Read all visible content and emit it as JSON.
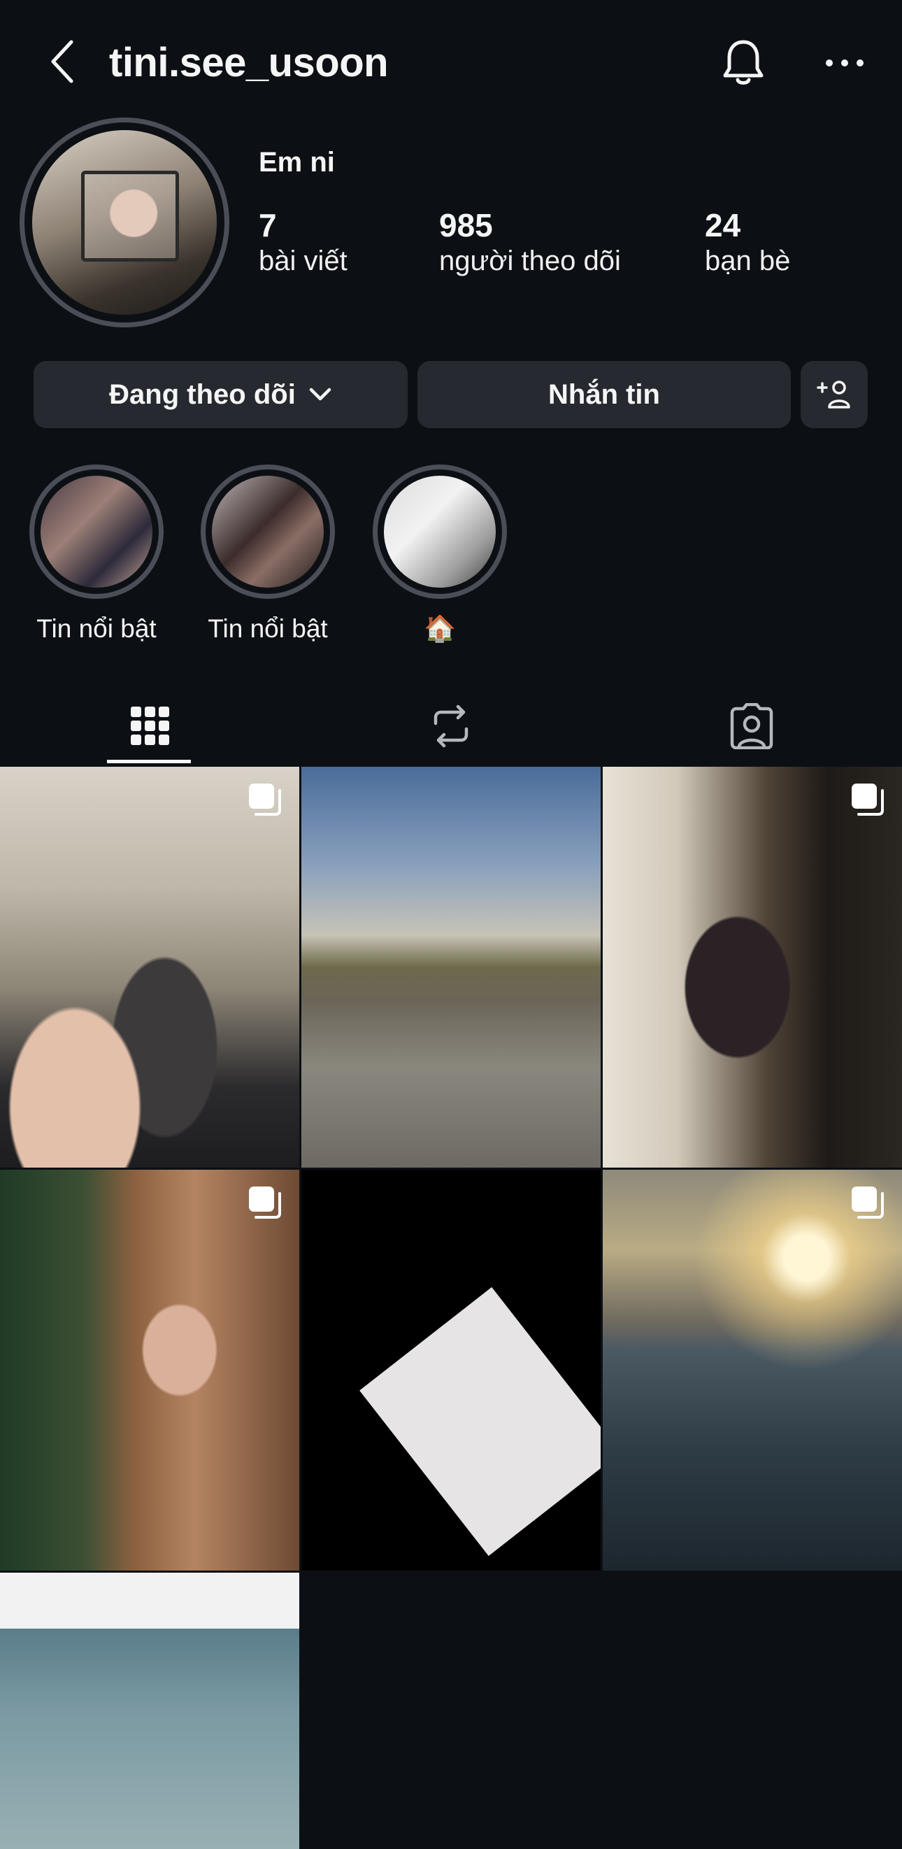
{
  "header": {
    "username": "tini.see_usoon",
    "back_icon": "chevron-left-icon",
    "bell_icon": "bell-icon",
    "more_icon": "more-horizontal-icon"
  },
  "profile": {
    "display_name": "Em ni",
    "stats": [
      {
        "value": "7",
        "label": "bài viết"
      },
      {
        "value": "985",
        "label": "người theo dõi"
      },
      {
        "value": "24",
        "label": "bạn bè"
      }
    ]
  },
  "actions": {
    "following_label": "Đang theo dõi",
    "message_label": "Nhắn tin",
    "add_user_icon": "person-plus-icon"
  },
  "highlights": [
    {
      "label": "Tin nổi bật"
    },
    {
      "label": "Tin nổi bật"
    },
    {
      "label": "🏠"
    }
  ],
  "tabs": [
    {
      "name": "posts",
      "icon": "grid-icon",
      "active": true
    },
    {
      "name": "reposts",
      "icon": "repost-icon",
      "active": false
    },
    {
      "name": "tagged",
      "icon": "tagged-person-icon",
      "active": false
    }
  ],
  "posts": [
    {
      "multi": true
    },
    {
      "multi": false
    },
    {
      "multi": true
    },
    {
      "multi": true
    },
    {
      "multi": false
    },
    {
      "multi": true
    },
    {
      "multi": false
    }
  ],
  "colors": {
    "background": "#0c1014",
    "button": "#262a30",
    "ring": "#4a4f57",
    "text": "#f5f5f5"
  }
}
